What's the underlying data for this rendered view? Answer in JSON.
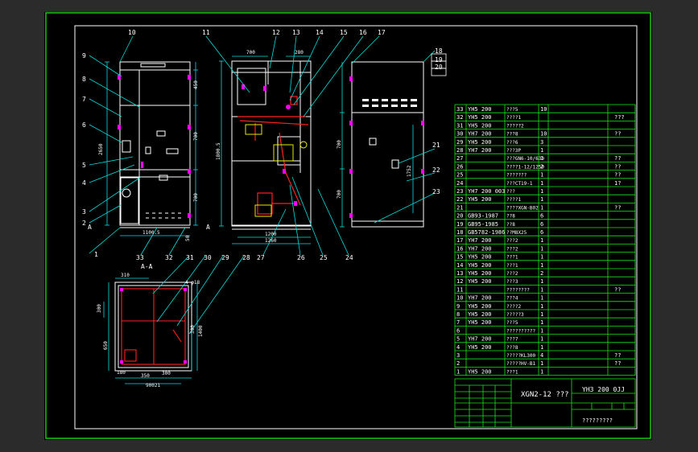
{
  "drawing": {
    "title_cn": "XGN2-12 ???",
    "drawing_no": "YH3 200 0JJ",
    "footer_note": "?????????",
    "section_label": "A-A",
    "view_marks": {
      "a_left": "A",
      "a_right": "A"
    }
  },
  "leaders_left": [
    "9",
    "8",
    "7",
    "6",
    "5",
    "4",
    "3",
    "2",
    "1",
    "10"
  ],
  "leaders_bottom": [
    "33",
    "32",
    "31",
    "30",
    "29",
    "28",
    "27",
    "26",
    "25",
    "24",
    "11",
    "12",
    "13",
    "14",
    "15",
    "16",
    "17",
    "18",
    "19",
    "20",
    "21",
    "22",
    "23"
  ],
  "dimensions": {
    "front_width": "1100.5",
    "front_h1": "450",
    "front_h2": "700",
    "front_h3": "700",
    "front_h4": "50",
    "front_left": "2650",
    "side_top": "700",
    "side_top2": "280",
    "side_height": "1800.5",
    "side_b1": "1200",
    "side_b2": "1260",
    "rear_a": "700",
    "rear_b": "700",
    "rear_side": "1752",
    "plan_w1": "310",
    "plan_w2": "350",
    "plan_w3": "300",
    "plan_w4": "90021",
    "plan_h1": "300",
    "plan_h2": "650",
    "plan_h3": "4-φ18",
    "plan_right": "1400",
    "plan_right2": "300",
    "plan_small": "180"
  },
  "bom": [
    {
      "no": "33",
      "code": "YH5 200",
      "name": "???5",
      "qty": "10",
      "note": ""
    },
    {
      "no": "32",
      "code": "YH5 200",
      "name": "????1",
      "qty": "",
      "note": "???"
    },
    {
      "no": "31",
      "code": "YH5 200",
      "name": "?????2",
      "qty": "",
      "note": ""
    },
    {
      "no": "30",
      "code": "YH7 200",
      "name": "???8",
      "qty": "10",
      "note": "??"
    },
    {
      "no": "29",
      "code": "YH5 200",
      "name": "???6",
      "qty": "3",
      "note": ""
    },
    {
      "no": "28",
      "code": "YH7 200",
      "name": "???3P",
      "qty": "1",
      "note": ""
    },
    {
      "no": "27",
      "code": "",
      "name": "???GN6-10/630",
      "qty": "1",
      "note": "??"
    },
    {
      "no": "26",
      "code": "",
      "name": "????1-12/1250",
      "qty": "2",
      "note": "??"
    },
    {
      "no": "25",
      "code": "",
      "name": "???????",
      "qty": "1",
      "note": "??"
    },
    {
      "no": "24",
      "code": "",
      "name": "???CT19-1",
      "qty": "1",
      "note": "1?"
    },
    {
      "no": "23",
      "code": "YH7 200 003",
      "name": "???",
      "qty": "1",
      "note": ""
    },
    {
      "no": "22",
      "code": "YH5 200",
      "name": "????1",
      "qty": "1",
      "note": ""
    },
    {
      "no": "21",
      "code": "",
      "name": "????XGN-B02",
      "qty": "1",
      "note": "??"
    },
    {
      "no": "20",
      "code": "GB93-1987",
      "name": "??8",
      "qty": "6",
      "note": ""
    },
    {
      "no": "19",
      "code": "GB95-1985",
      "name": "??8",
      "qty": "6",
      "note": ""
    },
    {
      "no": "18",
      "code": "GB5782-1986",
      "name": "??M8X25",
      "qty": "6",
      "note": ""
    },
    {
      "no": "17",
      "code": "YH7 200",
      "name": "???2",
      "qty": "1",
      "note": ""
    },
    {
      "no": "16",
      "code": "YH7 200",
      "name": "???2",
      "qty": "1",
      "note": ""
    },
    {
      "no": "15",
      "code": "YH5 200",
      "name": "???1",
      "qty": "1",
      "note": ""
    },
    {
      "no": "14",
      "code": "YH5 200",
      "name": "???1",
      "qty": "1",
      "note": ""
    },
    {
      "no": "13",
      "code": "YH5 200",
      "name": "???2",
      "qty": "2",
      "note": ""
    },
    {
      "no": "12",
      "code": "YH5 200",
      "name": "???3",
      "qty": "1",
      "note": ""
    },
    {
      "no": "11",
      "code": "",
      "name": "????????",
      "qty": "1",
      "note": "??"
    },
    {
      "no": "10",
      "code": "YH7 200",
      "name": "???4",
      "qty": "1",
      "note": ""
    },
    {
      "no": "9",
      "code": "YH5 200",
      "name": "????2",
      "qty": "1",
      "note": ""
    },
    {
      "no": "8",
      "code": "YH5 200",
      "name": "?????3",
      "qty": "1",
      "note": ""
    },
    {
      "no": "7",
      "code": "YH5 200",
      "name": "???5",
      "qty": "1",
      "note": ""
    },
    {
      "no": "6",
      "code": "",
      "name": "??????????",
      "qty": "1",
      "note": ""
    },
    {
      "no": "5",
      "code": "YH7 200",
      "name": "???7",
      "qty": "1",
      "note": ""
    },
    {
      "no": "4",
      "code": "YH5 200",
      "name": "???8",
      "qty": "1",
      "note": ""
    },
    {
      "no": "3",
      "code": "",
      "name": "?????KL300",
      "qty": "4",
      "note": "??"
    },
    {
      "no": "2",
      "code": "",
      "name": "?????HV-B1",
      "qty": "1",
      "note": "??"
    },
    {
      "no": "1",
      "code": "YH5 200",
      "name": "???1",
      "qty": "1",
      "note": ""
    }
  ],
  "colors": {
    "border": "#19e619",
    "frame": "#ffffff",
    "object": "#ffffff",
    "dim": "#00e0e0",
    "lead": "#00e0e0",
    "red": "#ff2020",
    "magenta": "#ff00ff",
    "yellow": "#ffff00",
    "table": "#19e619",
    "text": "#ffffff"
  }
}
